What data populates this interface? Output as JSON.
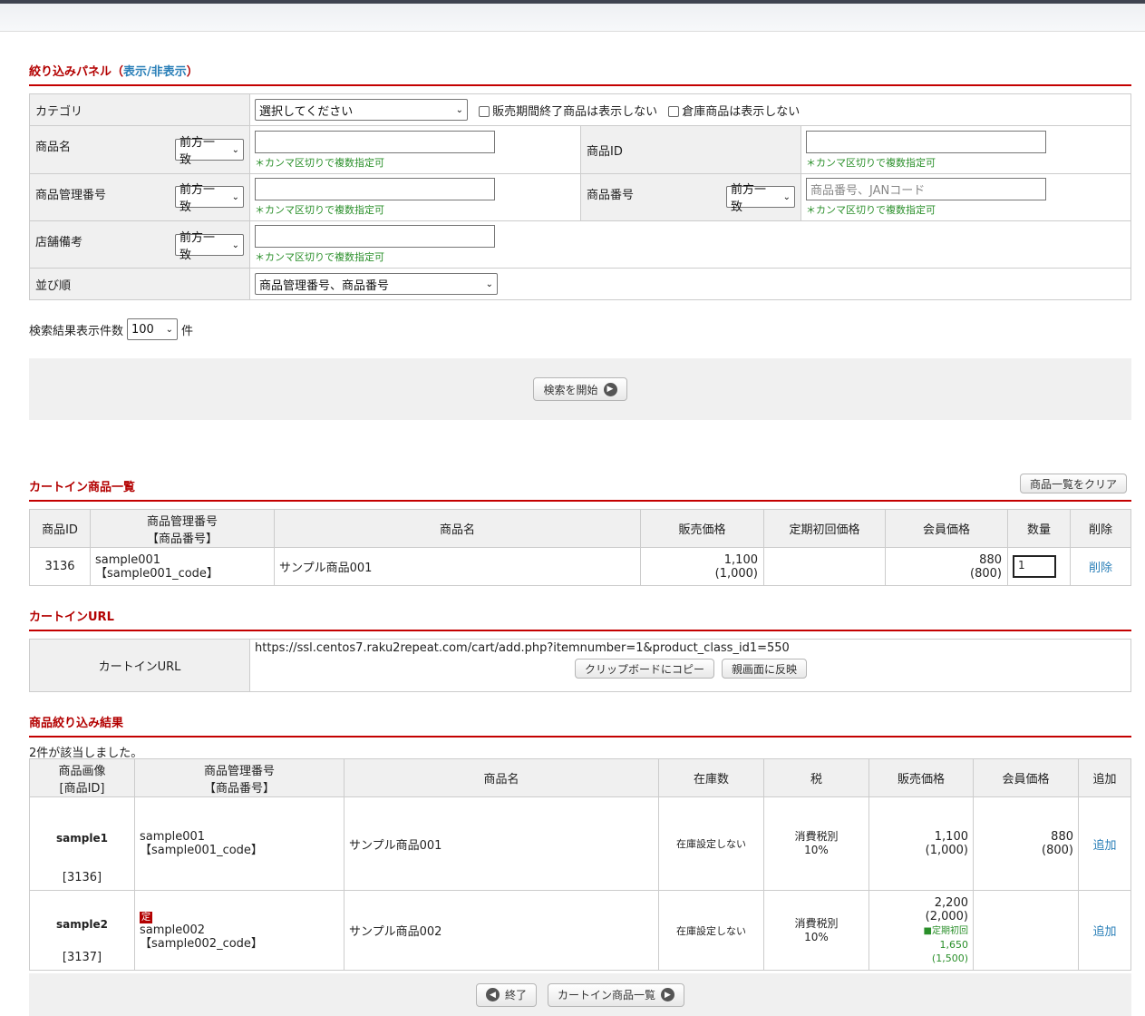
{
  "filter": {
    "title": "絞り込みパネル（",
    "toggle": "表示/非表示",
    "title_end": "）",
    "category_label": "カテゴリ",
    "category_select": "選択してください",
    "chk_discontinued": "販売期間終了商品は表示しない",
    "chk_warehouse": "倉庫商品は表示しない",
    "product_name_label": "商品名",
    "product_id_label": "商品ID",
    "mgmt_no_label": "商品管理番号",
    "product_no_label": "商品番号",
    "shop_note_label": "店舗備考",
    "sort_label": "並び順",
    "match_option": "前方一致",
    "comma_note": "＊カンマ区切りで複数指定可",
    "product_no_placeholder": "商品番号、JANコード",
    "sort_value": "商品管理番号、商品番号",
    "count_label": "検索結果表示件数",
    "count_value": "100",
    "count_unit": "件",
    "search_button": "検索を開始"
  },
  "cart": {
    "title": "カートイン商品一覧",
    "clear_button": "商品一覧をクリア",
    "headers": {
      "id": "商品ID",
      "mgmt": "商品管理番号",
      "mgmt_sub": "【商品番号】",
      "name": "商品名",
      "price": "販売価格",
      "first_price": "定期初回価格",
      "member_price": "会員価格",
      "qty": "数量",
      "delete": "削除"
    },
    "rows": [
      {
        "id": "3136",
        "mgmt": "sample001",
        "code": "【sample001_code】",
        "name": "サンプル商品001",
        "price": "1,100",
        "price_ex": "(1,000)",
        "member_price": "880",
        "member_price_ex": "(800)",
        "qty": "1",
        "delete": "削除"
      }
    ]
  },
  "url_section": {
    "title": "カートインURL",
    "label": "カートインURL",
    "url": "https://ssl.centos7.raku2repeat.com/cart/add.php?itemnumber=1&product_class_id1=550",
    "copy_button": "クリップボードにコピー",
    "apply_button": "親画面に反映"
  },
  "results": {
    "title": "商品絞り込み結果",
    "count_text": "2件が該当しました。",
    "headers": {
      "image": "商品画像",
      "image_sub": "[商品ID]",
      "mgmt": "商品管理番号",
      "mgmt_sub": "【商品番号】",
      "name": "商品名",
      "stock": "在庫数",
      "tax": "税",
      "price": "販売価格",
      "member_price": "会員価格",
      "add": "追加"
    },
    "rows": [
      {
        "image": "sample1",
        "pid": "[3136]",
        "mgmt": "sample001",
        "code": "【sample001_code】",
        "name": "サンプル商品001",
        "stock": "在庫設定しない",
        "tax": "消費税別",
        "tax_rate": "10%",
        "price": "1,100",
        "price_ex": "(1,000)",
        "member_price": "880",
        "member_price_ex": "(800)",
        "add": "追加"
      },
      {
        "image": "sample2",
        "pid": "[3137]",
        "badge": "定",
        "mgmt": "sample002",
        "code": "【sample002_code】",
        "name": "サンプル商品002",
        "stock": "在庫設定しない",
        "tax": "消費税別",
        "tax_rate": "10%",
        "price": "2,200",
        "price_ex": "(2,000)",
        "first_label": "■定期初回",
        "first_price": "1,650",
        "first_price_ex": "(1,500)",
        "add": "追加"
      }
    ]
  },
  "footer": {
    "close_button": "終了",
    "cart_list_button": "カートイン商品一覧"
  }
}
